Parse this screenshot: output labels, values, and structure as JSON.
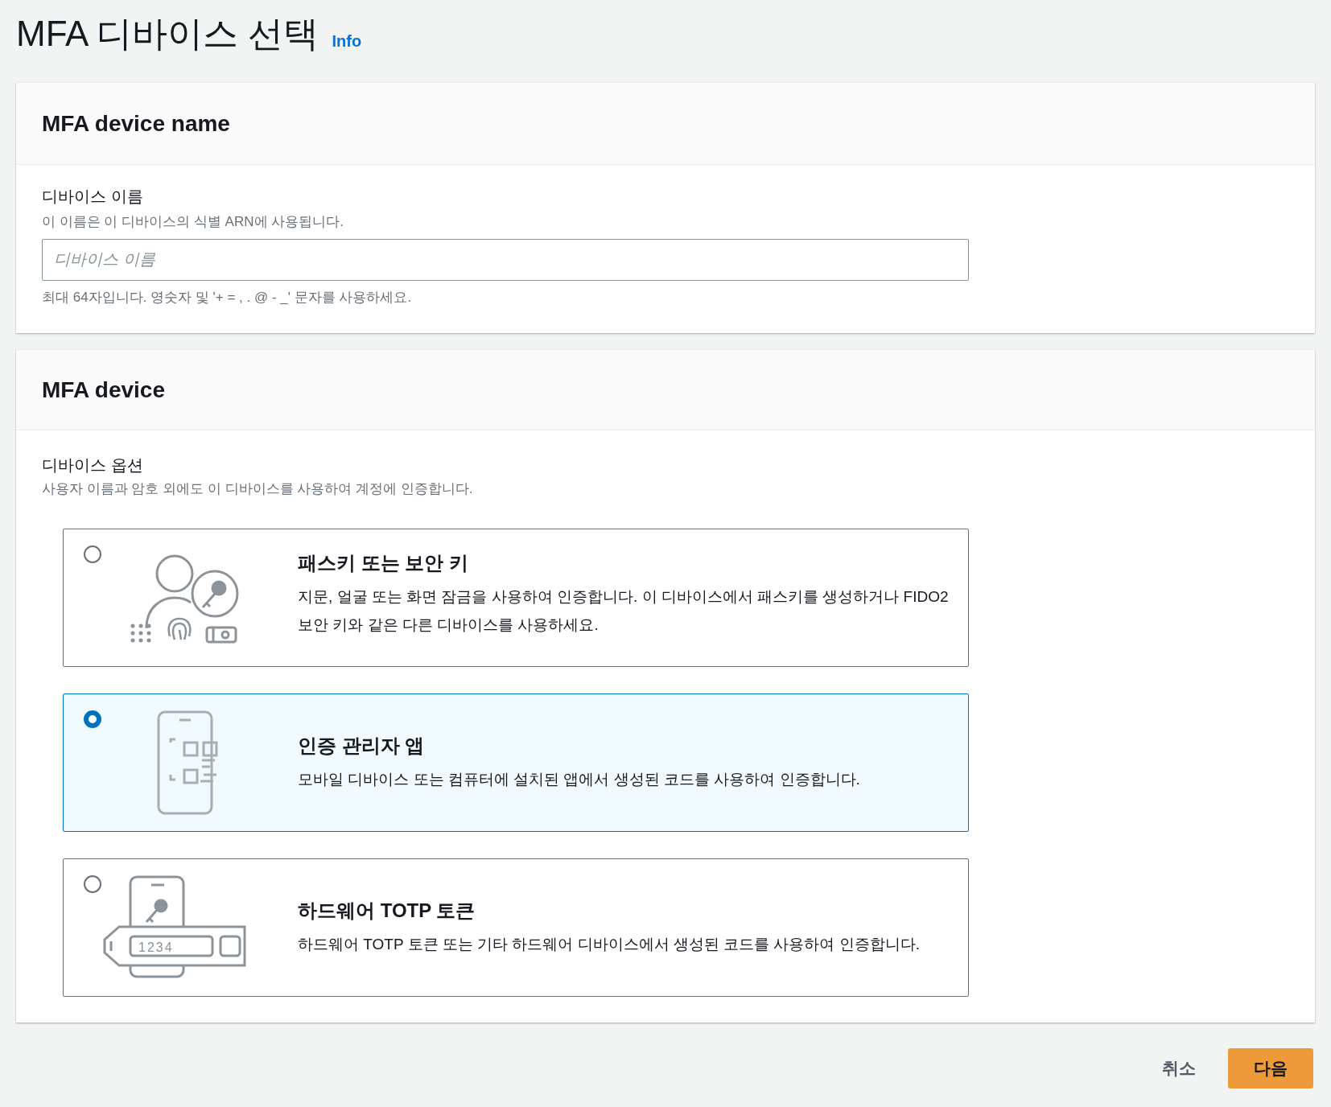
{
  "page": {
    "title": "MFA 디바이스 선택",
    "info_link": "Info"
  },
  "name_panel": {
    "heading": "MFA device name",
    "field": {
      "label": "디바이스 이름",
      "description": "이 이름은 이 디바이스의 식별 ARN에 사용됩니다.",
      "placeholder": "디바이스 이름",
      "constraint": "최대 64자입니다. 영숫자 및 '+ = , . @ - _' 문자를 사용하세요."
    }
  },
  "device_panel": {
    "heading": "MFA device",
    "label": "디바이스 옵션",
    "description": "사용자 이름과 암호 외에도 이 디바이스를 사용하여 계정에 인증합니다.",
    "options": [
      {
        "kind": "passkey",
        "title": "패스키 또는 보안 키",
        "description": "지문, 얼굴 또는 화면 잠금을 사용하여 인증합니다. 이 디바이스에서 패스키를 생성하거나 FIDO2 보안 키와 같은 다른 디바이스를 사용하세요.",
        "selected": false
      },
      {
        "kind": "app",
        "title": "인증 관리자 앱",
        "description": "모바일 디바이스 또는 컴퓨터에 설치된 앱에서 생성된 코드를 사용하여 인증합니다.",
        "selected": true
      },
      {
        "kind": "token",
        "title": "하드웨어 TOTP 토큰",
        "description": "하드웨어 TOTP 토큰 또는 기타 하드웨어 디바이스에서 생성된 코드를 사용하여 인증합니다.",
        "selected": false,
        "token_digits": "1234"
      }
    ]
  },
  "actions": {
    "cancel": "취소",
    "next": "다음"
  }
}
